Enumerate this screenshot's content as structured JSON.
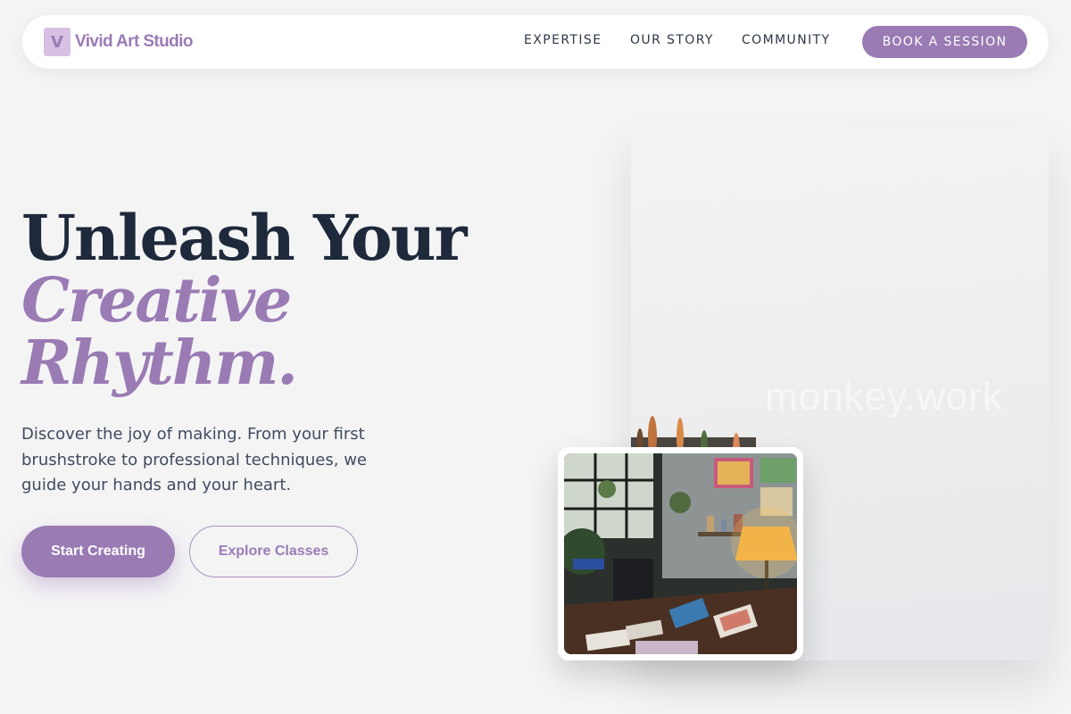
{
  "nav": {
    "brand": {
      "logo_letter": "V",
      "name": "Vivid Art Studio"
    },
    "links": [
      "EXPERTISE",
      "OUR STORY",
      "COMMUNITY"
    ],
    "cta": "BOOK A SESSION"
  },
  "hero": {
    "title_line1": "Unleash Your",
    "title_line2": "Creative",
    "title_line3": "Rhythm.",
    "description": "Discover the joy of making. From your first brushstroke to professional techniques, we guide your hands and your heart.",
    "primary_button": "Start Creating",
    "secondary_button": "Explore Classes"
  },
  "images": {
    "main_watermark": "monkey.work"
  },
  "colors": {
    "accent": "#9a7bb4",
    "logo_bg": "#d8c0e4",
    "heading_dark": "#1e293b",
    "background": "#f4f4f5"
  }
}
